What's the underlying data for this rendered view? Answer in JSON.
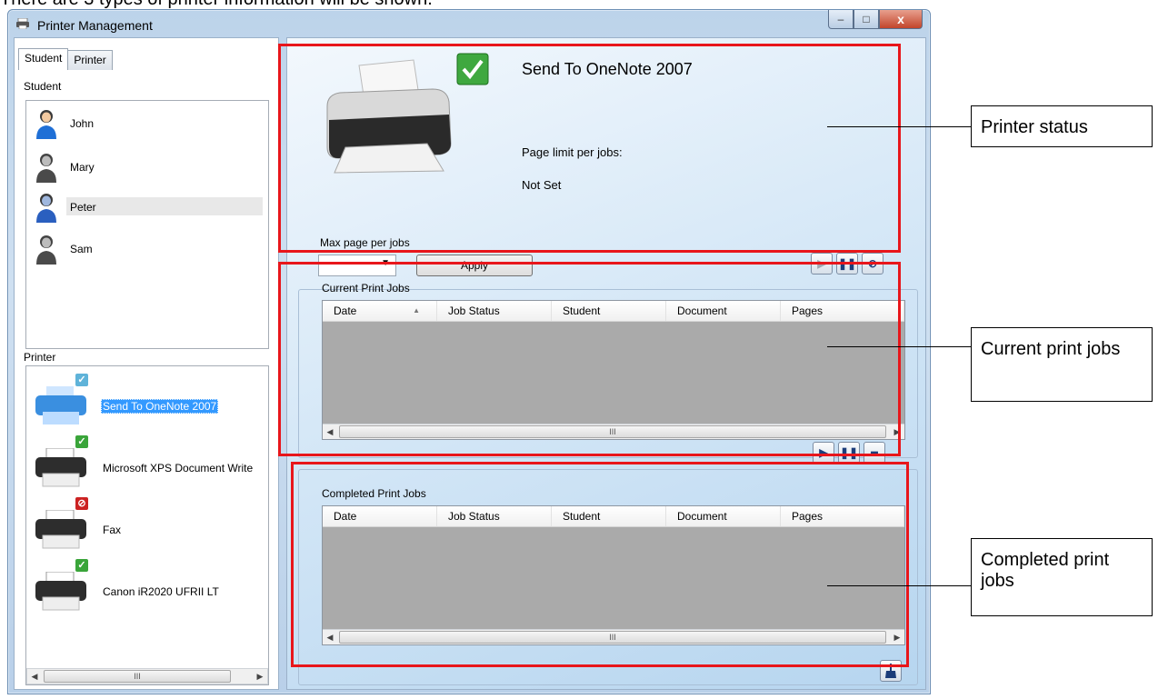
{
  "caption": "There are 3 types of printer information will be shown.",
  "window": {
    "title": "Printer Management",
    "minimize": "–",
    "maximize": "□",
    "close": "x"
  },
  "tabs": [
    {
      "label": "Student"
    },
    {
      "label": "Printer"
    }
  ],
  "student_group_label": "Student",
  "students": [
    {
      "name": "John"
    },
    {
      "name": "Mary"
    },
    {
      "name": "Peter"
    },
    {
      "name": "Sam"
    }
  ],
  "printer_group_label": "Printer",
  "printers": [
    {
      "name": "Send To OneNote 2007",
      "status": "ready"
    },
    {
      "name": "Microsoft XPS Document Write",
      "status": "ready"
    },
    {
      "name": "Fax",
      "status": "blocked"
    },
    {
      "name": "Canon iR2020 UFRII LT",
      "status": "ready"
    }
  ],
  "status_panel": {
    "printer_name": "Send To OneNote 2007",
    "page_limit_label": "Page limit per jobs:",
    "page_limit_value": "Not Set",
    "max_page_label": "Max page per jobs",
    "max_page_value": "",
    "apply_label": "Apply"
  },
  "current_jobs": {
    "title": "Current Print Jobs",
    "columns": [
      "Date",
      "Job Status",
      "Student",
      "Document",
      "Pages"
    ],
    "rows": []
  },
  "completed_jobs": {
    "title": "Completed Print Jobs",
    "columns": [
      "Date",
      "Job Status",
      "Student",
      "Document",
      "Pages"
    ],
    "rows": []
  },
  "scroll_thumb": "III",
  "callouts": {
    "printer_status": "Printer status",
    "current_print_jobs": "Current print jobs",
    "completed_print_jobs": "Completed print jobs"
  },
  "colors": {
    "annotation_red": "#e8161b",
    "selection": "#3399ff",
    "grid_empty": "#aaaaaa",
    "ready_badge": "#3aa53a",
    "blocked_badge": "#cc2222"
  },
  "icons": [
    "printer-icon",
    "check-icon",
    "block-icon",
    "play-icon",
    "pause-icon",
    "stop-icon",
    "user-icon",
    "clean-icon"
  ]
}
